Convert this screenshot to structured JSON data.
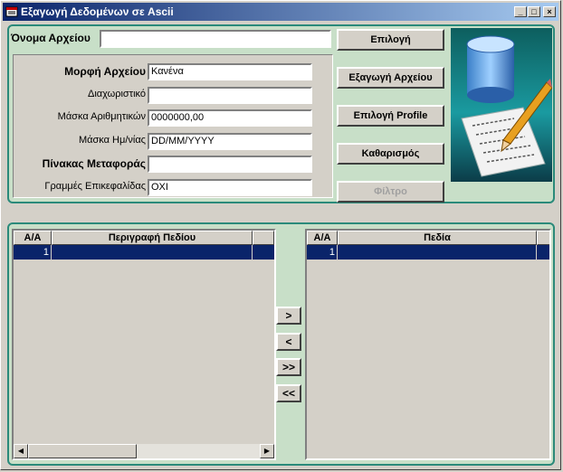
{
  "window": {
    "title": "Εξαγωγή Δεδομένων σε Ascii",
    "minimize": "_",
    "maximize": "□",
    "close": "×"
  },
  "form": {
    "file_name_label": "Όνομα Αρχείου",
    "file_name_value": "",
    "format_label": "Μορφή Αρχείου",
    "format_value": "Κανένα",
    "separator_label": "Διαχωριστικό",
    "separator_value": "",
    "numeric_mask_label": "Μάσκα Αριθμητικών",
    "numeric_mask_value": "0000000,00",
    "date_mask_label": "Μάσκα Ημ/νίας",
    "date_mask_value": "DD/MM/YYYY",
    "transfer_table_label": "Πίνακας Μεταφοράς",
    "transfer_table_value": "",
    "header_lines_label": "Γραμμές Επικεφαλίδας",
    "header_lines_value": "ΟΧΙ"
  },
  "buttons": {
    "select": "Επιλογή",
    "export": "Εξαγωγή Αρχείου",
    "select_profile": "Επιλογή Profile",
    "clear": "Καθαρισμός",
    "filter": "Φίλτρο"
  },
  "left_grid": {
    "col_aa": "Α/Α",
    "col_desc": "Περιγραφή Πεδίου",
    "rows": [
      {
        "aa": "1",
        "desc": ""
      }
    ]
  },
  "right_grid": {
    "col_aa": "Α/Α",
    "col_fields": "Πεδία",
    "rows": [
      {
        "aa": "1",
        "fields": ""
      }
    ]
  },
  "move": {
    "add": ">",
    "remove": "<",
    "add_all": ">>",
    "remove_all": "<<"
  },
  "colors": {
    "panel_bg": "#c8dfc8",
    "panel_border": "#2a8a7a",
    "selection": "#0a246a",
    "title_start": "#0a246a",
    "title_end": "#a6caf0"
  }
}
